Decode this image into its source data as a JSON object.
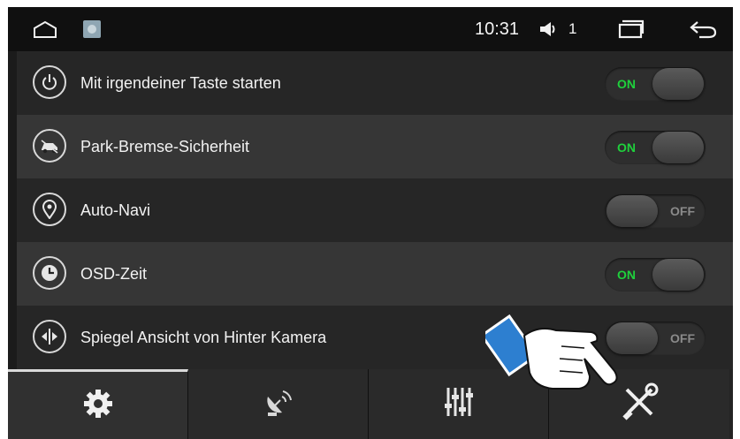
{
  "statusbar": {
    "time": "10:31",
    "volume_level": "1",
    "icons": [
      "home-icon",
      "app-thumbnail-icon",
      "speaker-icon",
      "recent-apps-icon",
      "back-icon"
    ]
  },
  "settings": [
    {
      "label": "Mit irgendeiner Taste starten",
      "icon": "power-icon",
      "state": "ON"
    },
    {
      "label": "Park-Bremse-Sicherheit",
      "icon": "car-brake-icon",
      "state": "ON"
    },
    {
      "label": "Auto-Navi",
      "icon": "location-pin-icon",
      "state": "OFF"
    },
    {
      "label": "OSD-Zeit",
      "icon": "clock-icon",
      "state": "ON"
    },
    {
      "label": "Spiegel Ansicht von Hinter Kamera",
      "icon": "mirror-icon",
      "state": "OFF"
    }
  ],
  "tabs": [
    {
      "icon": "gear-icon",
      "active": true
    },
    {
      "icon": "satellite-dish-icon",
      "active": false
    },
    {
      "icon": "equalizer-icon",
      "active": false
    },
    {
      "icon": "tools-icon",
      "active": false
    }
  ],
  "colors": {
    "on": "#1fd13c",
    "off": "#8a8a8a",
    "accent": "#2d7fd0"
  }
}
